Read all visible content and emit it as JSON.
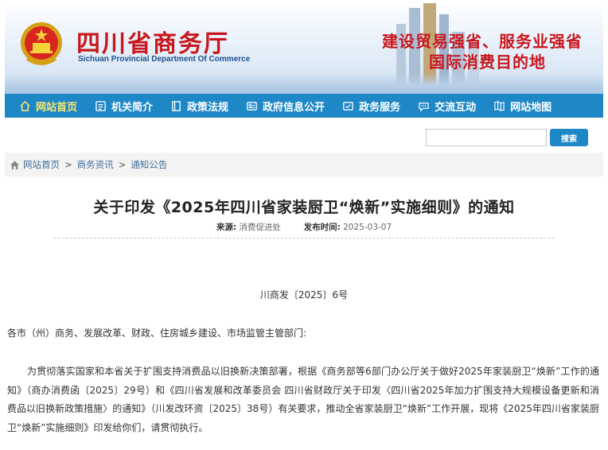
{
  "header": {
    "site_title": "四川省商务厅",
    "site_subtitle": "Sichuan Provincial Department Of Commerce",
    "slogan_line1": "建设贸易强省、服务业强省",
    "slogan_line2": "国际消费目的地",
    "emblem_icon": "national-emblem-icon"
  },
  "nav": {
    "items": [
      {
        "label": "网站首页",
        "icon": "home-icon",
        "active": true
      },
      {
        "label": "机关简介",
        "icon": "list-icon"
      },
      {
        "label": "政策法规",
        "icon": "book-icon"
      },
      {
        "label": "政府信息公开",
        "icon": "document-icon"
      },
      {
        "label": "政务服务",
        "icon": "service-icon"
      },
      {
        "label": "交流互动",
        "icon": "chat-icon"
      },
      {
        "label": "网站地图",
        "icon": "map-icon"
      }
    ],
    "bg_color": "#1e88c7",
    "active_color": "#ffe66a"
  },
  "search": {
    "placeholder": "",
    "value": "",
    "button_label": "搜索"
  },
  "breadcrumb": {
    "items": [
      "网站首页",
      "商务资讯",
      "通知公告"
    ],
    "separator": ">"
  },
  "article": {
    "title": "关于印发《2025年四川省家装厨卫“焕新”实施细则》的通知",
    "source_label": "来源:",
    "source_value": "消费促进处",
    "date_label": "发布时间:",
    "date_value": "2025-03-07",
    "doc_number": "川商发〔2025〕6号",
    "recipients": "各市（州）商务、发展改革、财政、住房城乡建设、市场监管主管部门:",
    "body": "为贯彻落实国家和本省关于扩围支持消费品以旧换新决策部署，根据《商务部等6部门办公厅关于做好2025年家装厨卫“焕新”工作的通知》（商办消费函〔2025〕29号）和《四川省发展和改革委员会 四川省财政厅关于印发〈四川省2025年加力扩围支持大规模设备更新和消费品以旧换新政策措施〉的通知》（川发改环资〔2025〕38号）有关要求，推动全省家装厨卫“焕新”工作开展，现将《2025年四川省家装厨卫“焕新”实施细则》印发给你们，请贯彻执行。"
  }
}
